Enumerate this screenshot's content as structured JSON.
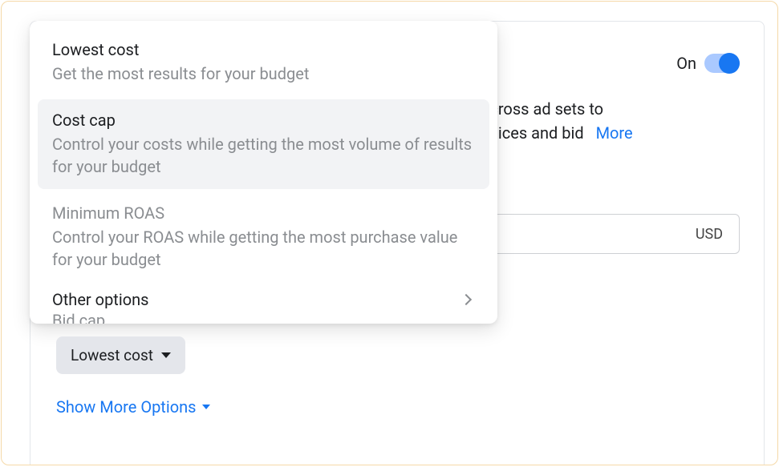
{
  "toggle": {
    "label": "On",
    "state": true
  },
  "description": {
    "line1": "t across ad sets to",
    "line2": "choices and bid",
    "more": "More"
  },
  "currency": {
    "code": "USD"
  },
  "dropdown": {
    "items": [
      {
        "title": "Lowest cost",
        "subtitle": "Get the most results for your budget",
        "highlighted": false,
        "disabled": false
      },
      {
        "title": "Cost cap",
        "subtitle": "Control your costs while getting the most volume of results for your budget",
        "highlighted": true,
        "disabled": false
      },
      {
        "title": "Minimum ROAS",
        "subtitle": "Control your ROAS while getting the most purchase value for your budget",
        "highlighted": false,
        "disabled": true
      }
    ],
    "other_options_label": "Other options",
    "peek_item": "Bid cap"
  },
  "chip": {
    "label": "Lowest cost"
  },
  "show_more": {
    "label": "Show More Options"
  }
}
